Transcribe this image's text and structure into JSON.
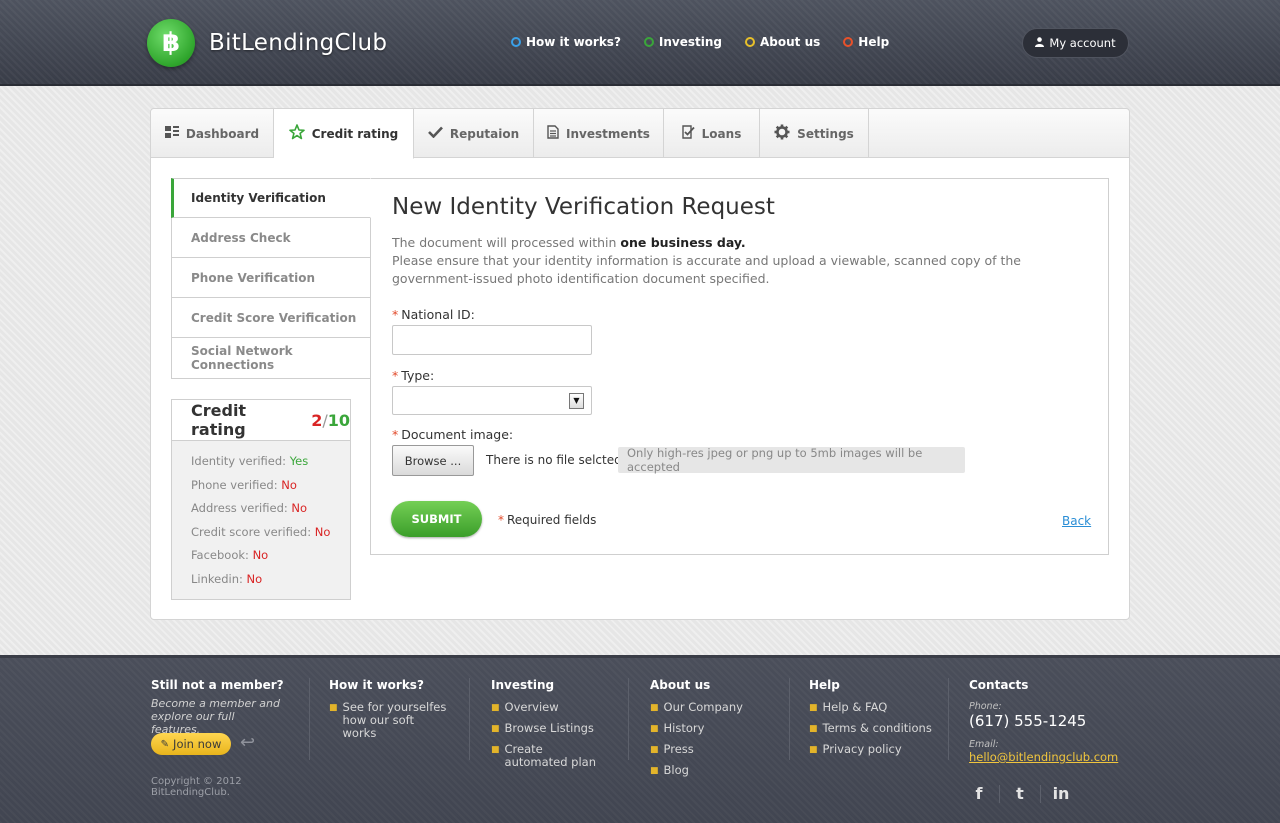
{
  "brand": {
    "name": "BitLendingClub",
    "coin_symbol": "฿"
  },
  "topnav": [
    {
      "label": "How it works?",
      "color": "#3aa0e8"
    },
    {
      "label": "Investing",
      "color": "#3aa63a"
    },
    {
      "label": "About us",
      "color": "#e8c02a"
    },
    {
      "label": "Help",
      "color": "#e8512a"
    }
  ],
  "account": {
    "label": "My account"
  },
  "tabs": [
    {
      "label": "Dashboard",
      "icon": "dashboard-icon"
    },
    {
      "label": "Credit rating",
      "icon": "star-icon"
    },
    {
      "label": "Reputaion",
      "icon": "check-icon"
    },
    {
      "label": "Investments",
      "icon": "document-icon"
    },
    {
      "label": "Loans",
      "icon": "checklist-icon"
    },
    {
      "label": "Settings",
      "icon": "gear-icon"
    }
  ],
  "sidebar": {
    "items": [
      {
        "label": "Identity Verification"
      },
      {
        "label": "Address Check"
      },
      {
        "label": "Phone Verification"
      },
      {
        "label": "Credit Score Verification"
      },
      {
        "label": "Social Network Connections"
      }
    ]
  },
  "rating": {
    "title": "Credit rating",
    "score": "2",
    "separator": "/",
    "max": "10",
    "rows": [
      {
        "label": "Identity verified:",
        "value": "Yes",
        "ok": true
      },
      {
        "label": "Phone verified:",
        "value": "No",
        "ok": false
      },
      {
        "label": "Address verified:",
        "value": "No",
        "ok": false
      },
      {
        "label": "Credit score verified:",
        "value": "No",
        "ok": false
      },
      {
        "label": "Facebook:",
        "value": "No",
        "ok": false
      },
      {
        "label": "Linkedin:",
        "value": "No",
        "ok": false
      }
    ]
  },
  "form": {
    "title": "New Identity Verification Request",
    "desc_prefix": "The document will processed within ",
    "desc_bold": "one business day.",
    "desc_line2": "Please ensure that your identity information is accurate and upload a viewable, scanned copy of the government-issued photo identification document specified.",
    "required_mark": "*",
    "national_id_label": "National ID:",
    "national_id_value": "",
    "type_label": "Type:",
    "type_value": "",
    "document_label": "Document image:",
    "browse_label": "Browse ...",
    "no_file_text": "There is no file selcted",
    "file_note": "Only high-res jpeg or png up to 5mb images will be accepted",
    "submit_label": "SUBMIT",
    "required_note": "Required fields",
    "back_label": "Back"
  },
  "footer": {
    "member": {
      "title": "Still not a member?",
      "text": "Become a member and explore our full features.",
      "join_label": "Join now",
      "copyright": "Copyright © 2012 BitLendingClub."
    },
    "how": {
      "title": "How it works?",
      "links": [
        "See for yourselfes how our soft works"
      ]
    },
    "investing": {
      "title": "Investing",
      "links": [
        "Overview",
        "Browse Listings",
        "Create automated plan"
      ]
    },
    "about": {
      "title": "About us",
      "links": [
        "Our Company",
        "History",
        "Press",
        "Blog"
      ]
    },
    "help": {
      "title": "Help",
      "links": [
        "Help & FAQ",
        "Terms & conditions",
        "Privacy policy"
      ]
    },
    "contacts": {
      "title": "Contacts",
      "phone_label": "Phone:",
      "phone": "(617) 555-1245",
      "email_label": "Email:",
      "email": "hello@bitlendingclub.com"
    },
    "socials": [
      "facebook-icon",
      "twitter-icon",
      "linkedin-icon"
    ]
  }
}
